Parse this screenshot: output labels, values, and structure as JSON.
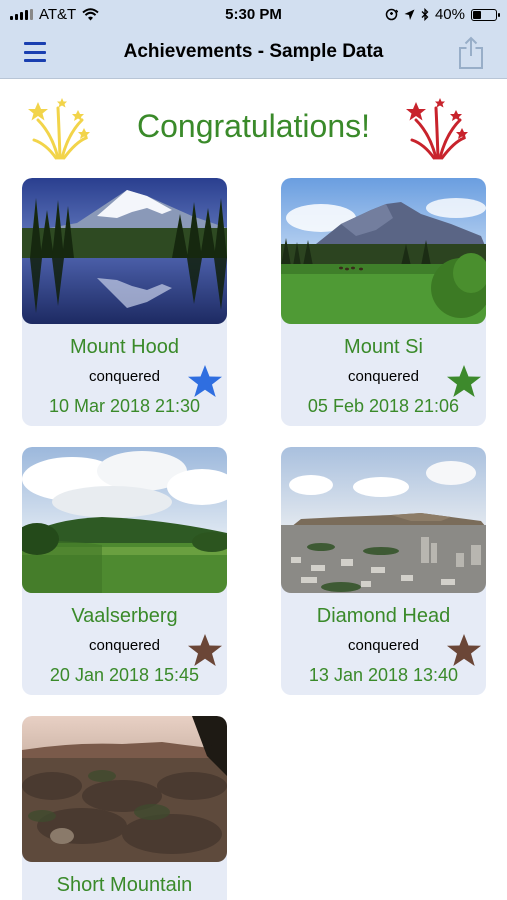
{
  "status_bar": {
    "carrier": "AT&T",
    "time": "5:30 PM",
    "battery": "40%",
    "battery_level": 0.4
  },
  "nav": {
    "title": "Achievements - Sample Data",
    "menu_icon": "hamburger-menu-icon",
    "share_icon": "share-icon"
  },
  "header": {
    "title": "Congratulations!",
    "left_icon": "fireworks-icon",
    "right_icon": "fireworks-icon",
    "left_color": "#f2d44a",
    "right_color": "#c8232c"
  },
  "colors": {
    "accent_green": "#3a8a2a",
    "card_bg": "#e6ebf6",
    "bar_bg": "#d2dff0"
  },
  "achievements": [
    {
      "name": "Mount Hood",
      "status": "conquered",
      "date": "10 Mar 2018 21:30",
      "star_color": "#2f6ee0"
    },
    {
      "name": "Mount Si",
      "status": "conquered",
      "date": "05 Feb 2018 21:06",
      "star_color": "#3d8a2c"
    },
    {
      "name": "Vaalserberg",
      "status": "conquered",
      "date": "20 Jan 2018 15:45",
      "star_color": "#6b4637"
    },
    {
      "name": "Diamond Head",
      "status": "conquered",
      "date": "13 Jan 2018 13:40",
      "star_color": "#6b4637"
    },
    {
      "name": "Short Mountain",
      "status": "",
      "date": "",
      "star_color": ""
    }
  ]
}
